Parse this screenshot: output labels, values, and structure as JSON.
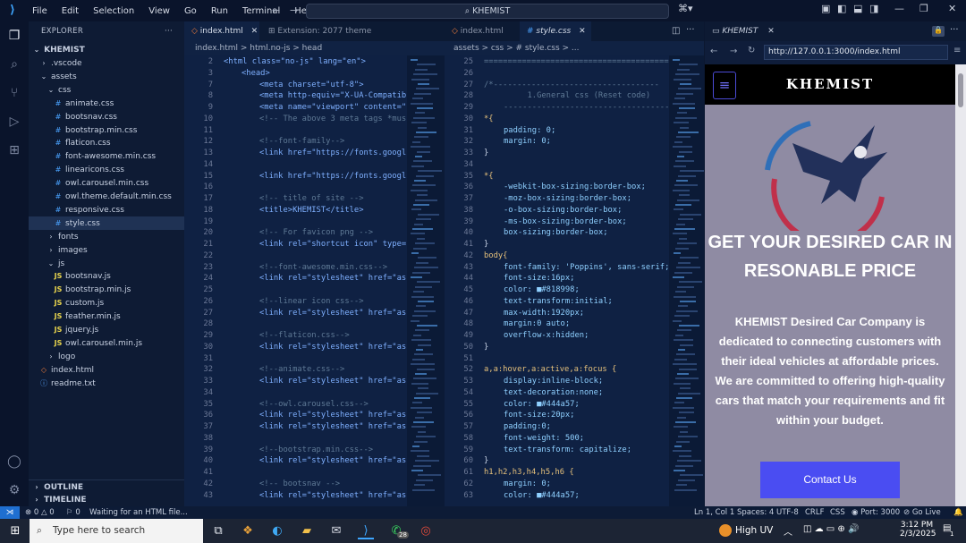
{
  "titlebar": {
    "menu": [
      "File",
      "Edit",
      "Selection",
      "View",
      "Go",
      "Run",
      "Terminal",
      "Help"
    ],
    "search": "KHEMIST"
  },
  "explorer": {
    "header": "EXPLORER",
    "root": "KHEMIST",
    "items": [
      {
        "label": ".vscode",
        "kind": "folder-closed",
        "depth": 1
      },
      {
        "label": "assets",
        "kind": "folder-open",
        "depth": 1
      },
      {
        "label": "css",
        "kind": "folder-open",
        "depth": 2
      },
      {
        "label": "animate.css",
        "kind": "css",
        "depth": 3
      },
      {
        "label": "bootsnav.css",
        "kind": "css",
        "depth": 3
      },
      {
        "label": "bootstrap.min.css",
        "kind": "css",
        "depth": 3
      },
      {
        "label": "flaticon.css",
        "kind": "css",
        "depth": 3
      },
      {
        "label": "font-awesome.min.css",
        "kind": "css",
        "depth": 3
      },
      {
        "label": "linearicons.css",
        "kind": "css",
        "depth": 3
      },
      {
        "label": "owl.carousel.min.css",
        "kind": "css",
        "depth": 3
      },
      {
        "label": "owl.theme.default.min.css",
        "kind": "css",
        "depth": 3
      },
      {
        "label": "responsive.css",
        "kind": "css",
        "depth": 3
      },
      {
        "label": "style.css",
        "kind": "css",
        "depth": 3,
        "selected": true
      },
      {
        "label": "fonts",
        "kind": "folder-closed",
        "depth": 2
      },
      {
        "label": "images",
        "kind": "folder-closed",
        "depth": 2
      },
      {
        "label": "js",
        "kind": "folder-open",
        "depth": 2
      },
      {
        "label": "bootsnav.js",
        "kind": "js",
        "depth": 3
      },
      {
        "label": "bootstrap.min.js",
        "kind": "js",
        "depth": 3
      },
      {
        "label": "custom.js",
        "kind": "js",
        "depth": 3
      },
      {
        "label": "feather.min.js",
        "kind": "js",
        "depth": 3
      },
      {
        "label": "jquery.js",
        "kind": "js",
        "depth": 3
      },
      {
        "label": "owl.carousel.min.js",
        "kind": "js",
        "depth": 3
      },
      {
        "label": "logo",
        "kind": "folder-closed",
        "depth": 2
      },
      {
        "label": "index.html",
        "kind": "html",
        "depth": 1
      },
      {
        "label": "readme.txt",
        "kind": "txt",
        "depth": 1
      }
    ],
    "outline": "OUTLINE",
    "timeline": "TIMELINE"
  },
  "editor1": {
    "tabs": [
      "index.html",
      "Extension: 2077 theme"
    ],
    "breadcrumb": "index.html > html.no-js > head",
    "lines": [
      {
        "n": "2",
        "t": "<html class=\"no-js\" lang=\"en\">",
        "ind": 0
      },
      {
        "n": "3",
        "t": "<head>",
        "ind": 1
      },
      {
        "n": "7",
        "t": "<meta charset=\"utf-8\">",
        "ind": 2
      },
      {
        "n": "8",
        "t": "<meta http-equiv=\"X-UA-Compatib",
        "ind": 2
      },
      {
        "n": "9",
        "t": "<meta name=\"viewport\" content=\"",
        "ind": 2
      },
      {
        "n": "10",
        "t": "<!-- The above 3 meta tags *mus",
        "ind": 2,
        "c": 1
      },
      {
        "n": "11",
        "t": "",
        "ind": 2
      },
      {
        "n": "12",
        "t": "<!--font-family-->",
        "ind": 2,
        "c": 1
      },
      {
        "n": "13",
        "t": "<link href=\"https://fonts.googl",
        "ind": 2
      },
      {
        "n": "14",
        "t": "",
        "ind": 2
      },
      {
        "n": "15",
        "t": "<link href=\"https://fonts.googl",
        "ind": 2
      },
      {
        "n": "16",
        "t": "",
        "ind": 2
      },
      {
        "n": "17",
        "t": "<!-- title of site -->",
        "ind": 2,
        "c": 1
      },
      {
        "n": "18",
        "t": "<title>KHEMIST</title>",
        "ind": 2
      },
      {
        "n": "19",
        "t": "",
        "ind": 2
      },
      {
        "n": "20",
        "t": "<!-- For favicon png -->",
        "ind": 2,
        "c": 1
      },
      {
        "n": "21",
        "t": "<link rel=\"shortcut icon\" type=",
        "ind": 2
      },
      {
        "n": "22",
        "t": "",
        "ind": 2
      },
      {
        "n": "23",
        "t": "<!--font-awesome.min.css-->",
        "ind": 2,
        "c": 1
      },
      {
        "n": "24",
        "t": "<link rel=\"stylesheet\" href=\"as",
        "ind": 2
      },
      {
        "n": "25",
        "t": "",
        "ind": 2
      },
      {
        "n": "26",
        "t": "<!--linear icon css-->",
        "ind": 2,
        "c": 1
      },
      {
        "n": "27",
        "t": "<link rel=\"stylesheet\" href=\"as",
        "ind": 2
      },
      {
        "n": "28",
        "t": "",
        "ind": 2
      },
      {
        "n": "29",
        "t": "<!--flaticon.css-->",
        "ind": 2,
        "c": 1
      },
      {
        "n": "30",
        "t": "<link rel=\"stylesheet\" href=\"as",
        "ind": 2
      },
      {
        "n": "31",
        "t": "",
        "ind": 2
      },
      {
        "n": "32",
        "t": "<!--animate.css-->",
        "ind": 2,
        "c": 1
      },
      {
        "n": "33",
        "t": "<link rel=\"stylesheet\" href=\"as",
        "ind": 2
      },
      {
        "n": "34",
        "t": "",
        "ind": 2
      },
      {
        "n": "35",
        "t": "<!--owl.carousel.css-->",
        "ind": 2,
        "c": 1
      },
      {
        "n": "36",
        "t": "<link rel=\"stylesheet\" href=\"as",
        "ind": 2
      },
      {
        "n": "37",
        "t": "<link rel=\"stylesheet\" href=\"as",
        "ind": 2
      },
      {
        "n": "38",
        "t": "",
        "ind": 2
      },
      {
        "n": "39",
        "t": "<!--bootstrap.min.css-->",
        "ind": 2,
        "c": 1
      },
      {
        "n": "40",
        "t": "<link rel=\"stylesheet\" href=\"as",
        "ind": 2
      },
      {
        "n": "41",
        "t": "",
        "ind": 2
      },
      {
        "n": "42",
        "t": "<!-- bootsnav -->",
        "ind": 2,
        "c": 1
      },
      {
        "n": "43",
        "t": "<link rel=\"stylesheet\" href=\"as",
        "ind": 2
      }
    ]
  },
  "editor2": {
    "tabs": [
      "index.html",
      "style.css"
    ],
    "breadcrumb": "assets > css > # style.css > ...",
    "lines": [
      {
        "n": "25",
        "t": "=========================================",
        "ind": 0,
        "c": 1
      },
      {
        "n": "26",
        "t": "",
        "ind": 0
      },
      {
        "n": "27",
        "t": "/*-----------------------------------",
        "ind": 0,
        "c": 1
      },
      {
        "n": "28",
        "t": "     1.General css (Reset code)",
        "ind": 1,
        "c": 1
      },
      {
        "n": "29",
        "t": "-------------------------------------*",
        "ind": 1,
        "c": 1
      },
      {
        "n": "30",
        "t": "*{",
        "ind": 0,
        "k": "sel"
      },
      {
        "n": "31",
        "t": "padding: 0;",
        "ind": 1,
        "k": "prop"
      },
      {
        "n": "32",
        "t": "margin: 0;",
        "ind": 1,
        "k": "prop"
      },
      {
        "n": "33",
        "t": "}",
        "ind": 0
      },
      {
        "n": "34",
        "t": "",
        "ind": 0
      },
      {
        "n": "35",
        "t": "*{",
        "ind": 0,
        "k": "sel"
      },
      {
        "n": "36",
        "t": "-webkit-box-sizing:border-box;",
        "ind": 1,
        "k": "prop"
      },
      {
        "n": "37",
        "t": "-moz-box-sizing:border-box;",
        "ind": 1,
        "k": "prop"
      },
      {
        "n": "38",
        "t": "-o-box-sizing:border-box;",
        "ind": 1,
        "k": "prop"
      },
      {
        "n": "39",
        "t": "-ms-box-sizing:border-box;",
        "ind": 1,
        "k": "prop"
      },
      {
        "n": "40",
        "t": "box-sizing:border-box;",
        "ind": 1,
        "k": "prop"
      },
      {
        "n": "41",
        "t": "}",
        "ind": 0
      },
      {
        "n": "42",
        "t": "body{",
        "ind": 0,
        "k": "sel"
      },
      {
        "n": "43",
        "t": "font-family: 'Poppins', sans-serif;",
        "ind": 1,
        "k": "prop"
      },
      {
        "n": "44",
        "t": "font-size:16px;",
        "ind": 1,
        "k": "prop"
      },
      {
        "n": "45",
        "t": "color: ■#818998;",
        "ind": 1,
        "k": "prop"
      },
      {
        "n": "46",
        "t": "text-transform:initial;",
        "ind": 1,
        "k": "prop"
      },
      {
        "n": "47",
        "t": "max-width:1920px;",
        "ind": 1,
        "k": "prop"
      },
      {
        "n": "48",
        "t": "margin:0 auto;",
        "ind": 1,
        "k": "prop"
      },
      {
        "n": "49",
        "t": "overflow-x:hidden;",
        "ind": 1,
        "k": "prop"
      },
      {
        "n": "50",
        "t": "}",
        "ind": 0
      },
      {
        "n": "51",
        "t": "",
        "ind": 0
      },
      {
        "n": "52",
        "t": "a,a:hover,a:active,a:focus {",
        "ind": 0,
        "k": "sel"
      },
      {
        "n": "53",
        "t": "display:inline-block;",
        "ind": 1,
        "k": "prop"
      },
      {
        "n": "54",
        "t": "text-decoration:none;",
        "ind": 1,
        "k": "prop"
      },
      {
        "n": "55",
        "t": "color: ■#444a57;",
        "ind": 1,
        "k": "prop"
      },
      {
        "n": "56",
        "t": "font-size:20px;",
        "ind": 1,
        "k": "prop"
      },
      {
        "n": "57",
        "t": "padding:0;",
        "ind": 1,
        "k": "prop"
      },
      {
        "n": "58",
        "t": "font-weight: 500;",
        "ind": 1,
        "k": "prop"
      },
      {
        "n": "59",
        "t": "text-transform: capitalize;",
        "ind": 1,
        "k": "prop"
      },
      {
        "n": "60",
        "t": "}",
        "ind": 0
      },
      {
        "n": "61",
        "t": "h1,h2,h3,h4,h5,h6 {",
        "ind": 0,
        "k": "sel"
      },
      {
        "n": "62",
        "t": "margin: 0;",
        "ind": 1,
        "k": "prop"
      },
      {
        "n": "63",
        "t": "color: ■#444a57;",
        "ind": 1,
        "k": "prop"
      }
    ]
  },
  "browser": {
    "tab": "KHEMIST",
    "url": "http://127.0.0.1:3000/index.html",
    "site": {
      "brand": "KHEMIST",
      "headline": "GET YOUR DESIRED CAR IN RESONABLE PRICE",
      "paragraph": "KHEMIST Desired Car Company is dedicated to connecting customers with their ideal vehicles at affordable prices. We are committed to offering high-quality cars that match your requirements and fit within your budget.",
      "cta": "Contact Us"
    }
  },
  "statusbar": {
    "errors": "0",
    "warnings": "0",
    "ports": "0",
    "message": "Waiting for an HTML file...",
    "position": "Ln 1, Col 1",
    "spaces": "Spaces: 4",
    "encoding": "UTF-8",
    "eol": "CRLF",
    "lang": "CSS",
    "port": "Port: 3000",
    "golive": "Go Live"
  },
  "taskbar": {
    "search": "Type here to search",
    "weather": "High UV",
    "time": "3:12 PM",
    "date": "2/3/2025",
    "badge": "28",
    "notif": "1"
  },
  "colors": {
    "accent": "#1f6fd1",
    "cta": "#4a4df2",
    "site_bg": "#8f8ba3"
  }
}
